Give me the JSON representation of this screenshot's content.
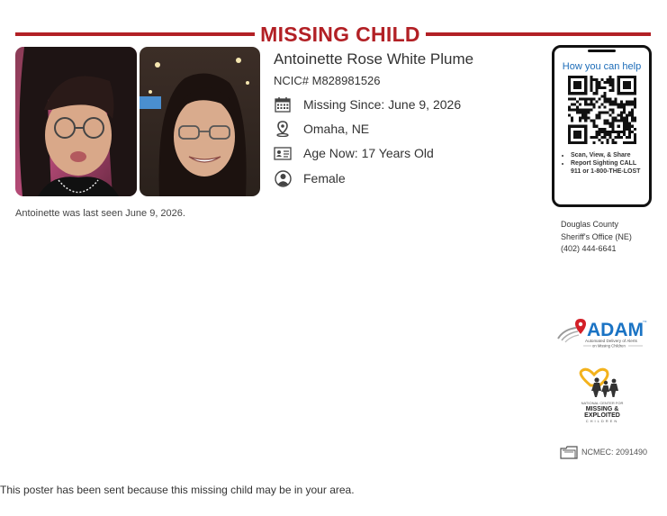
{
  "header": {
    "title": "MISSING CHILD"
  },
  "child": {
    "name": "Antoinette Rose White Plume",
    "ncic": "NCIC# M828981526",
    "missing_since": "Missing Since: June 9, 2026",
    "location": "Omaha, NE",
    "age_now": "Age Now: 17 Years Old",
    "sex": "Female",
    "last_seen": "Antoinette was last seen June 9, 2026."
  },
  "phone_card": {
    "heading": "How you can help",
    "bullets": [
      "Scan, View, & Share",
      "Report Sighting CALL 911 or 1-800-THE-LOST"
    ]
  },
  "agency": {
    "line1": "Douglas County",
    "line2": "Sheriff's Office (NE)",
    "phone": "(402) 444-6641"
  },
  "adam_logo": {
    "word": "ADAM",
    "line1": "Automated Delivery of Alerts",
    "line2": "on Missing Children",
    "tm": "TM"
  },
  "ncmec_logo": {
    "line1": "NATIONAL CENTER FOR",
    "line2": "MISSING &",
    "line3": "EXPLOITED",
    "line4": "CHILDREN"
  },
  "ncmec_id": "NCMEC: 2091490",
  "footer": "This poster has been sent because this missing child may be in your area.",
  "colors": {
    "brand_red": "#b22025",
    "link_blue": "#1c6cb8",
    "adam_blue": "#1a73c4"
  },
  "icons": [
    "calendar-icon",
    "location-pin-icon",
    "id-card-icon",
    "person-icon",
    "folder-icon"
  ]
}
